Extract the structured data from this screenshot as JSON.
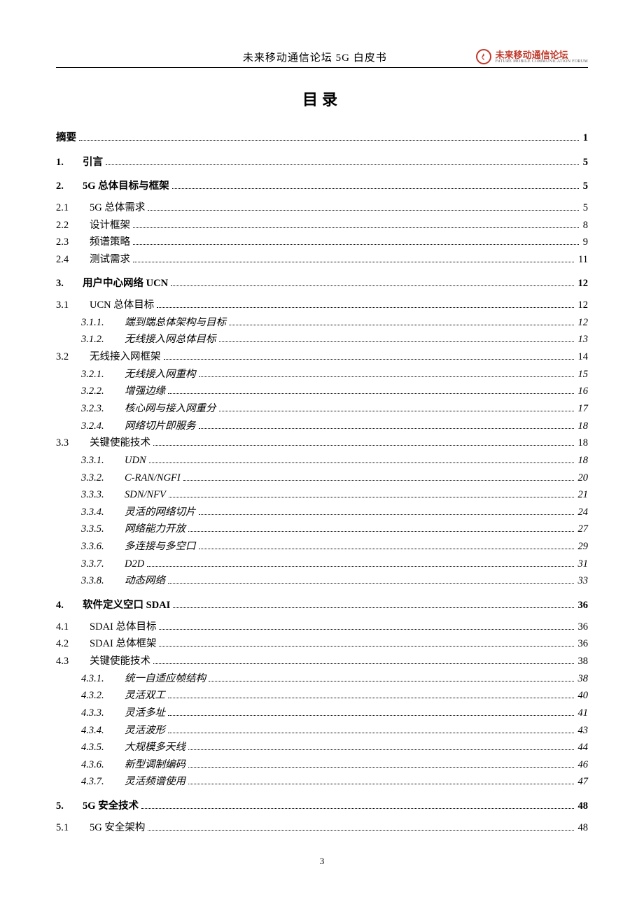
{
  "header": {
    "title": "未来移动通信论坛 5G 白皮书",
    "logo_text": "未来移动通信论坛",
    "logo_sub": "FuTURE MOBILE COMMUNICATION FORUM"
  },
  "toc_title": "目录",
  "footer_page": "3",
  "toc": [
    {
      "level": 0,
      "num": "",
      "label": "摘要",
      "page": "1"
    },
    {
      "level": 1,
      "num": "1.",
      "label": "引言",
      "page": "5"
    },
    {
      "level": 1,
      "num": "2.",
      "label": "5G 总体目标与框架",
      "page": "5"
    },
    {
      "level": 2,
      "num": "2.1",
      "label": "5G 总体需求",
      "page": "5"
    },
    {
      "level": 2,
      "num": "2.2",
      "label": "设计框架",
      "page": "8"
    },
    {
      "level": 2,
      "num": "2.3",
      "label": "频谱策略",
      "page": "9"
    },
    {
      "level": 2,
      "num": "2.4",
      "label": "测试需求",
      "page": "11"
    },
    {
      "level": 1,
      "num": "3.",
      "label": "用户中心网络 UCN",
      "page": "12"
    },
    {
      "level": 2,
      "num": "3.1",
      "label": "UCN 总体目标",
      "page": "12"
    },
    {
      "level": 3,
      "num": "3.1.1.",
      "label": "端到端总体架构与目标",
      "page": "12"
    },
    {
      "level": 3,
      "num": "3.1.2.",
      "label": "无线接入网总体目标",
      "page": "13"
    },
    {
      "level": 2,
      "num": "3.2",
      "label": "无线接入网框架",
      "page": "14"
    },
    {
      "level": 3,
      "num": "3.2.1.",
      "label": "无线接入网重构",
      "page": "15"
    },
    {
      "level": 3,
      "num": "3.2.2.",
      "label": "增强边缘",
      "page": "16"
    },
    {
      "level": 3,
      "num": "3.2.3.",
      "label": "核心网与接入网重分",
      "page": "17"
    },
    {
      "level": 3,
      "num": "3.2.4.",
      "label": "网络切片即服务",
      "page": "18"
    },
    {
      "level": 2,
      "num": "3.3",
      "label": "关键使能技术",
      "page": "18"
    },
    {
      "level": 3,
      "num": "3.3.1.",
      "label": "UDN",
      "page": "18"
    },
    {
      "level": 3,
      "num": "3.3.2.",
      "label": "C-RAN/NGFI",
      "page": "20"
    },
    {
      "level": 3,
      "num": "3.3.3.",
      "label": "SDN/NFV",
      "page": "21"
    },
    {
      "level": 3,
      "num": "3.3.4.",
      "label": "灵活的网络切片",
      "page": "24"
    },
    {
      "level": 3,
      "num": "3.3.5.",
      "label": "网络能力开放",
      "page": "27"
    },
    {
      "level": 3,
      "num": "3.3.6.",
      "label": "多连接与多空口",
      "page": "29"
    },
    {
      "level": 3,
      "num": "3.3.7.",
      "label": "D2D",
      "page": "31"
    },
    {
      "level": 3,
      "num": "3.3.8.",
      "label": "动态网络",
      "page": "33"
    },
    {
      "level": 1,
      "num": "4.",
      "label": "软件定义空口 SDAI",
      "page": "36"
    },
    {
      "level": 2,
      "num": "4.1",
      "label": "SDAI 总体目标",
      "page": "36"
    },
    {
      "level": 2,
      "num": "4.2",
      "label": "SDAI 总体框架",
      "page": "36"
    },
    {
      "level": 2,
      "num": "4.3",
      "label": "关键使能技术",
      "page": "38"
    },
    {
      "level": 3,
      "num": "4.3.1.",
      "label": "统一自适应帧结构",
      "page": "38"
    },
    {
      "level": 3,
      "num": "4.3.2.",
      "label": "灵活双工",
      "page": "40"
    },
    {
      "level": 3,
      "num": "4.3.3.",
      "label": "灵活多址",
      "page": "41"
    },
    {
      "level": 3,
      "num": "4.3.4.",
      "label": "灵活波形",
      "page": "43"
    },
    {
      "level": 3,
      "num": "4.3.5.",
      "label": "大规模多天线",
      "page": "44"
    },
    {
      "level": 3,
      "num": "4.3.6.",
      "label": "新型调制编码",
      "page": "46"
    },
    {
      "level": 3,
      "num": "4.3.7.",
      "label": "灵活频谱使用",
      "page": "47"
    },
    {
      "level": 1,
      "num": "5.",
      "label": "5G 安全技术",
      "page": "48"
    },
    {
      "level": 2,
      "num": "5.1",
      "label": "5G 安全架构",
      "page": "48"
    }
  ]
}
